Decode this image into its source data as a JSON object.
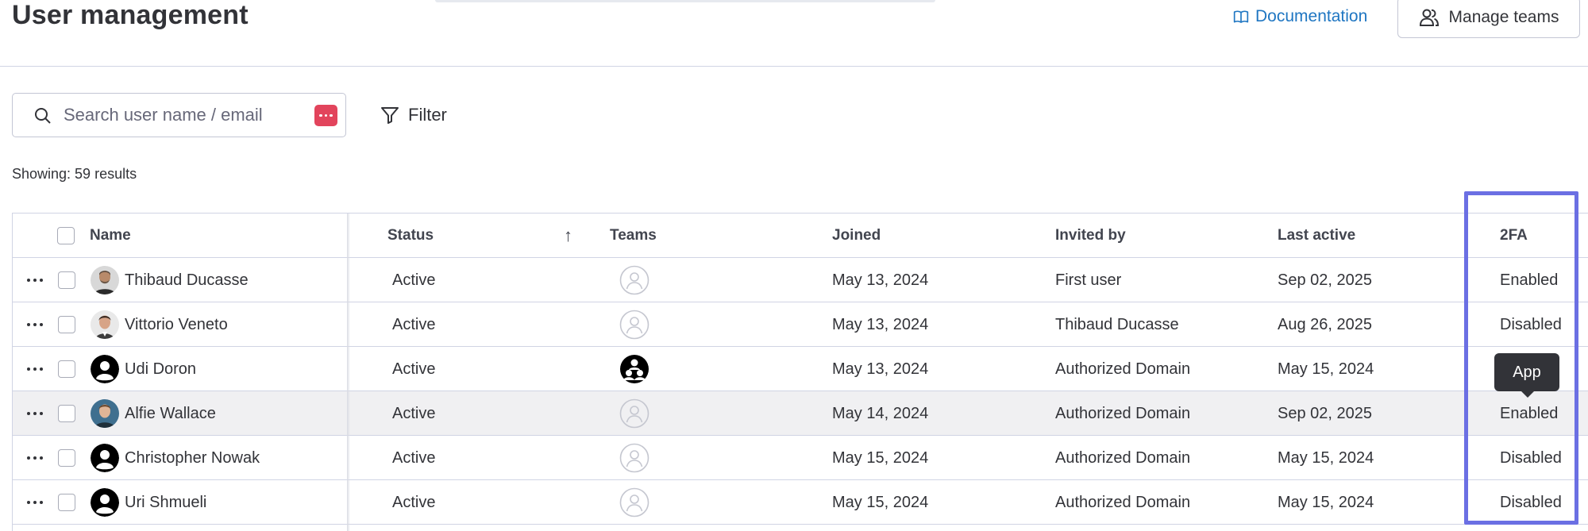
{
  "header": {
    "title": "User management",
    "documentation_label": "Documentation",
    "manage_teams_label": "Manage teams"
  },
  "search": {
    "placeholder": "Search user name / email",
    "value": ""
  },
  "filter": {
    "label": "Filter"
  },
  "results": {
    "showing": "Showing: 59 results"
  },
  "table": {
    "columns": {
      "name": "Name",
      "status": "Status",
      "sort_indicator": "↑",
      "teams": "Teams",
      "joined": "Joined",
      "invited_by": "Invited by",
      "last_active": "Last active",
      "two_fa": "2FA"
    },
    "rows": [
      {
        "name": "Thibaud Ducasse",
        "avatar": "photo-avatar",
        "status": "Active",
        "team": "empty-team-icon",
        "joined": "May 13, 2024",
        "invited_by": "First user",
        "last_active": "Sep 02, 2025",
        "two_fa": "Enabled"
      },
      {
        "name": "Vittorio Veneto",
        "avatar": "photo-avatar",
        "status": "Active",
        "team": "empty-team-icon",
        "joined": "May 13, 2024",
        "invited_by": "Thibaud Ducasse",
        "last_active": "Aug 26, 2025",
        "two_fa": "Disabled"
      },
      {
        "name": "Udi Doron",
        "avatar": "default-avatar",
        "status": "Active",
        "team": "team-group-icon",
        "joined": "May 13, 2024",
        "invited_by": "Authorized Domain",
        "last_active": "May 15, 2024",
        "two_fa": ""
      },
      {
        "name": "Alfie Wallace",
        "avatar": "photo-avatar",
        "status": "Active",
        "team": "empty-team-icon",
        "joined": "May 14, 2024",
        "invited_by": "Authorized Domain",
        "last_active": "Sep 02, 2025",
        "two_fa": "Enabled"
      },
      {
        "name": "Christopher Nowak",
        "avatar": "default-avatar",
        "status": "Active",
        "team": "empty-team-icon",
        "joined": "May 15, 2024",
        "invited_by": "Authorized Domain",
        "last_active": "May 15, 2024",
        "two_fa": "Disabled"
      },
      {
        "name": "Uri Shmueli",
        "avatar": "default-avatar",
        "status": "Active",
        "team": "empty-team-icon",
        "joined": "May 15, 2024",
        "invited_by": "Authorized Domain",
        "last_active": "May 15, 2024",
        "two_fa": "Disabled"
      }
    ]
  },
  "tooltip": {
    "text": "App"
  },
  "colors": {
    "link": "#1f76c2",
    "highlight": "#6b6fe3",
    "password_badge": "#e2445c",
    "tooltip_bg": "#323338",
    "hover_row": "#f0f0f2"
  }
}
